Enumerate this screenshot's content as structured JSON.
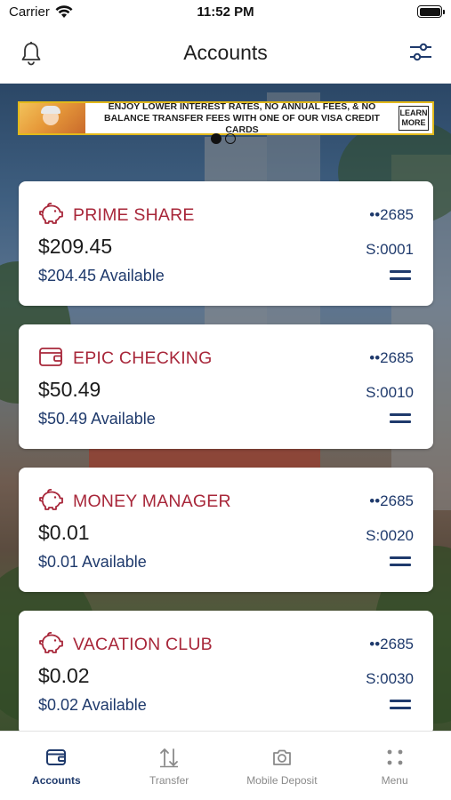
{
  "status_bar": {
    "carrier": "Carrier",
    "time": "11:52 PM"
  },
  "header": {
    "title": "Accounts"
  },
  "banner": {
    "text": "ENJOY LOWER INTEREST RATES, NO ANNUAL FEES, & NO BALANCE TRANSFER FEES WITH ONE OF OUR VISA CREDIT CARDS",
    "cta": "LEARN MORE",
    "current_page": 1,
    "page_count": 2
  },
  "accounts": [
    {
      "name": "PRIME SHARE",
      "account": "••2685",
      "balance": "$209.45",
      "suffix": "S:0001",
      "available": "$204.45 Available",
      "icon": "piggy-bank-icon"
    },
    {
      "name": "EPIC CHECKING",
      "account": "••2685",
      "balance": "$50.49",
      "suffix": "S:0010",
      "available": "$50.49 Available",
      "icon": "wallet-icon"
    },
    {
      "name": "MONEY MANAGER",
      "account": "••2685",
      "balance": "$0.01",
      "suffix": "S:0020",
      "available": "$0.01 Available",
      "icon": "piggy-bank-icon"
    },
    {
      "name": "VACATION CLUB",
      "account": "••2685",
      "balance": "$0.02",
      "suffix": "S:0030",
      "available": "$0.02 Available",
      "icon": "piggy-bank-icon"
    }
  ],
  "tabs": [
    {
      "label": "Accounts",
      "icon": "wallet-icon",
      "active": true
    },
    {
      "label": "Transfer",
      "icon": "transfer-arrows-icon",
      "active": false
    },
    {
      "label": "Mobile Deposit",
      "icon": "camera-icon",
      "active": false
    },
    {
      "label": "Menu",
      "icon": "grid-dots-icon",
      "active": false
    }
  ],
  "colors": {
    "brand_red": "#a8273a",
    "brand_navy": "#1f3a6c",
    "banner_border": "#e2b91a"
  }
}
